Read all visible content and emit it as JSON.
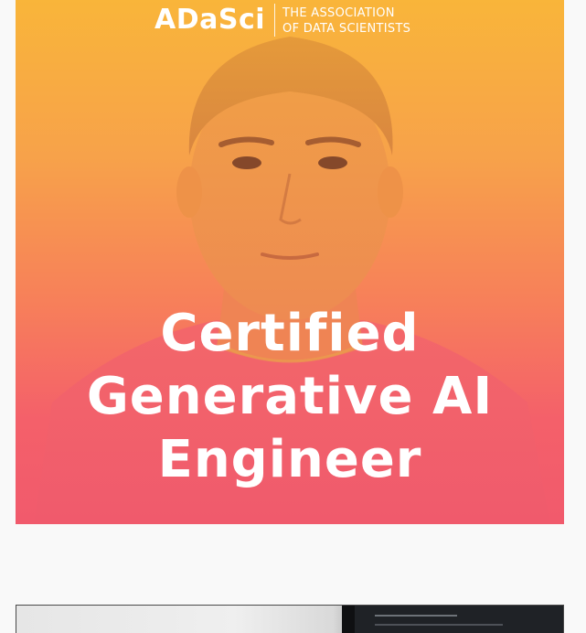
{
  "promo": {
    "brand": "ADaSci",
    "tagline_line1": "THE ASSOCIATION",
    "tagline_line2": "OF DATA SCIENTISTS",
    "headline_line1": "Certified",
    "headline_line2": "Generative AI",
    "headline_line3": "Engineer",
    "colors": {
      "gradient_top": "#f9b53a",
      "gradient_mid": "#f77f5a",
      "gradient_bottom": "#f15a6c",
      "text": "#ffffff"
    }
  },
  "preview": {
    "description_icon": "laptop-screenshot-thumbnail"
  },
  "page": {
    "background": "#f9f9f9"
  }
}
